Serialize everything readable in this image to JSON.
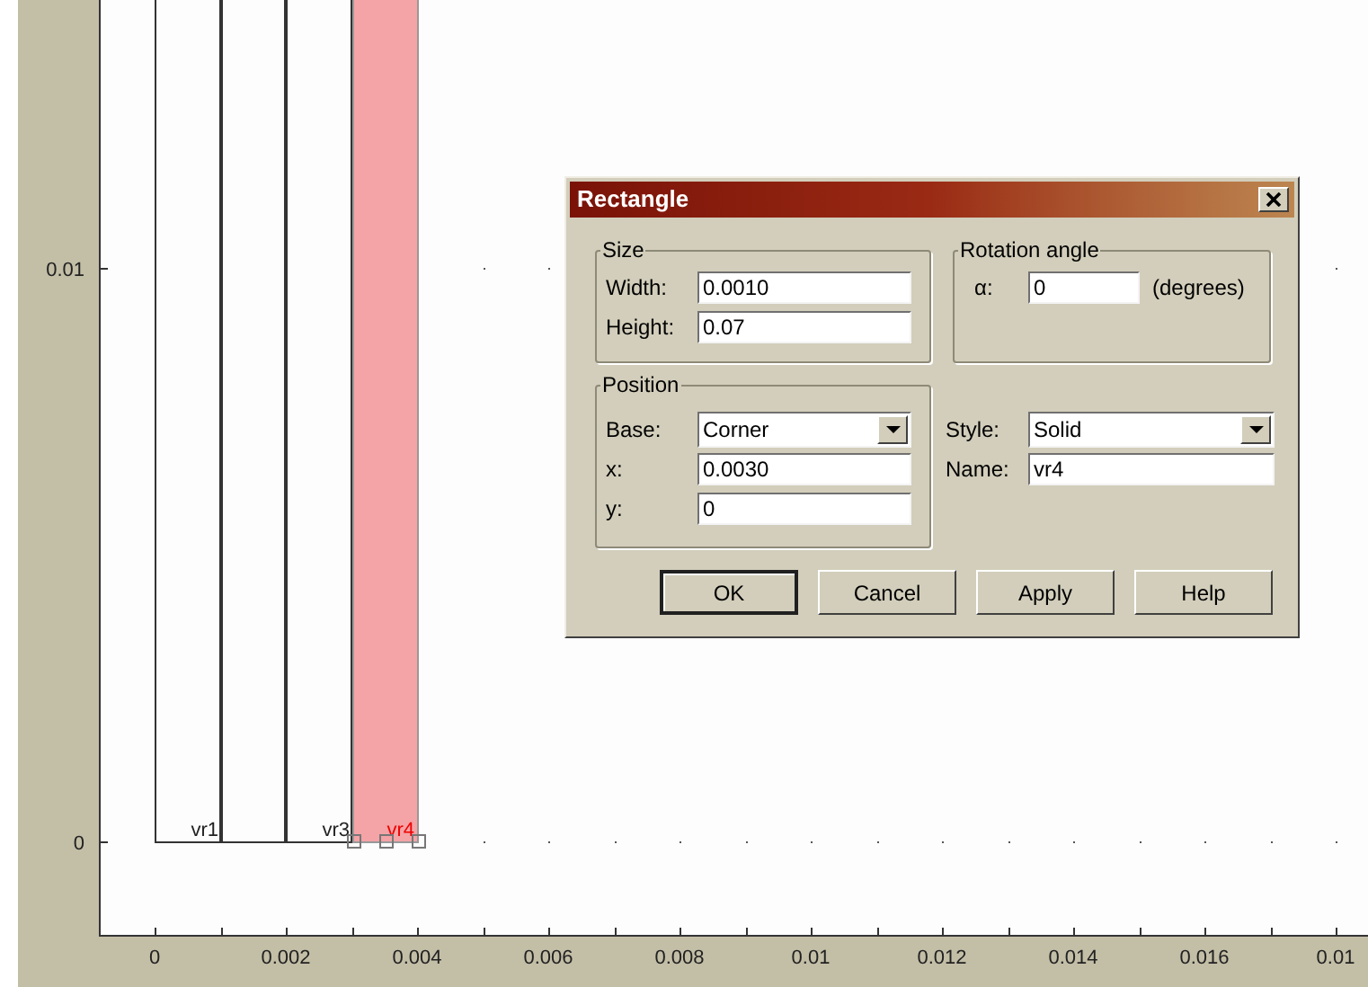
{
  "plot": {
    "y_ticks": [
      "0.01",
      "0"
    ],
    "x_ticks": [
      "0",
      "0.002",
      "0.004",
      "0.006",
      "0.008",
      "0.01",
      "0.012",
      "0.014",
      "0.016",
      "0.01"
    ],
    "shapes": [
      {
        "label": "vr1",
        "selected": false
      },
      {
        "selected": false
      },
      {
        "label": "vr3",
        "selected": false
      },
      {
        "label": "vr4",
        "selected": true
      }
    ]
  },
  "dialog": {
    "title": "Rectangle",
    "size": {
      "legend": "Size",
      "fields": [
        {
          "label": "Width:",
          "value": "0.0010"
        },
        {
          "label": "Height:",
          "value": "0.07"
        }
      ]
    },
    "rotation": {
      "legend": "Rotation angle",
      "label": "α:",
      "value": "0",
      "unit": "(degrees)"
    },
    "position": {
      "legend": "Position",
      "base": {
        "label": "Base:",
        "value": "Corner"
      },
      "fields": [
        {
          "label": "x:",
          "value": "0.0030"
        },
        {
          "label": "y:",
          "value": "0"
        }
      ]
    },
    "style": {
      "label": "Style:",
      "value": "Solid"
    },
    "name": {
      "label": "Name:",
      "value": "vr4"
    },
    "buttons": [
      {
        "label": "OK",
        "default": true
      },
      {
        "label": "Cancel",
        "default": false
      },
      {
        "label": "Apply",
        "default": false
      },
      {
        "label": "Help",
        "default": false
      }
    ]
  }
}
